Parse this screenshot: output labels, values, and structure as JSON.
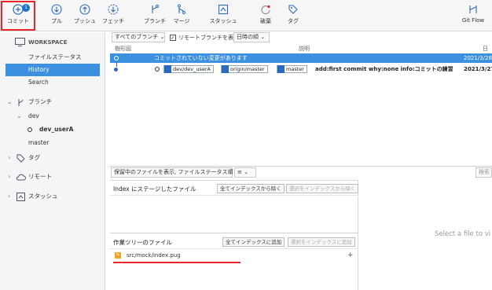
{
  "toolbar": {
    "commit": {
      "label": "コミット",
      "badge": "1"
    },
    "pull": "プル",
    "push": "プッシュ",
    "fetch": "フェッチ",
    "branch": "ブランチ",
    "merge": "マージ",
    "stash": "スタッシュ",
    "discard": "破棄",
    "tag": "タグ",
    "gitflow": "Git Flow"
  },
  "sidebar": {
    "workspace_header": "WORKSPACE",
    "workspace_items": [
      "ファイルステータス",
      "History",
      "Search"
    ],
    "branches_header": "ブランチ",
    "branch_group": "dev",
    "current_branch": "dev_userA",
    "master": "master",
    "tags_header": "タグ",
    "remote_header": "リモート",
    "stash_header": "スタッシュ"
  },
  "history": {
    "filters": {
      "branches": "すべてのブランチ",
      "show_remote_checkbox": "リモートブランチを表示",
      "order": "日時の順"
    },
    "columns": {
      "graph": "樹形図",
      "desc": "説明",
      "date": "日"
    },
    "rows": [
      {
        "desc": "コミットされていない変更があります",
        "date": "2021/3/28"
      },
      {
        "tags": [
          "dev/dev_userA",
          "origin/master",
          "master"
        ],
        "desc": "add:first commit why:none info:コミットの練習",
        "date": "2021/3/27"
      }
    ]
  },
  "files": {
    "filter_dropdown": "保留中のファイルを表示, ファイルステータス順",
    "search_placeholder": "検索",
    "staged_title": "Index にステージしたファイル",
    "unstage_all": "全てインデックスから除く",
    "unstage_selected": "選択をインデックスから除く",
    "working_title": "作業ツリーのファイル",
    "stage_all": "全てインデックスに追加",
    "stage_selected": "選択をインデックスに追加",
    "working_files": [
      "src/mock/index.pug"
    ],
    "diff_placeholder": "Select a file to vi"
  },
  "colors": {
    "accent": "#3c90e0",
    "highlight": "#e8262a",
    "file_icon": "#f2a31b"
  }
}
